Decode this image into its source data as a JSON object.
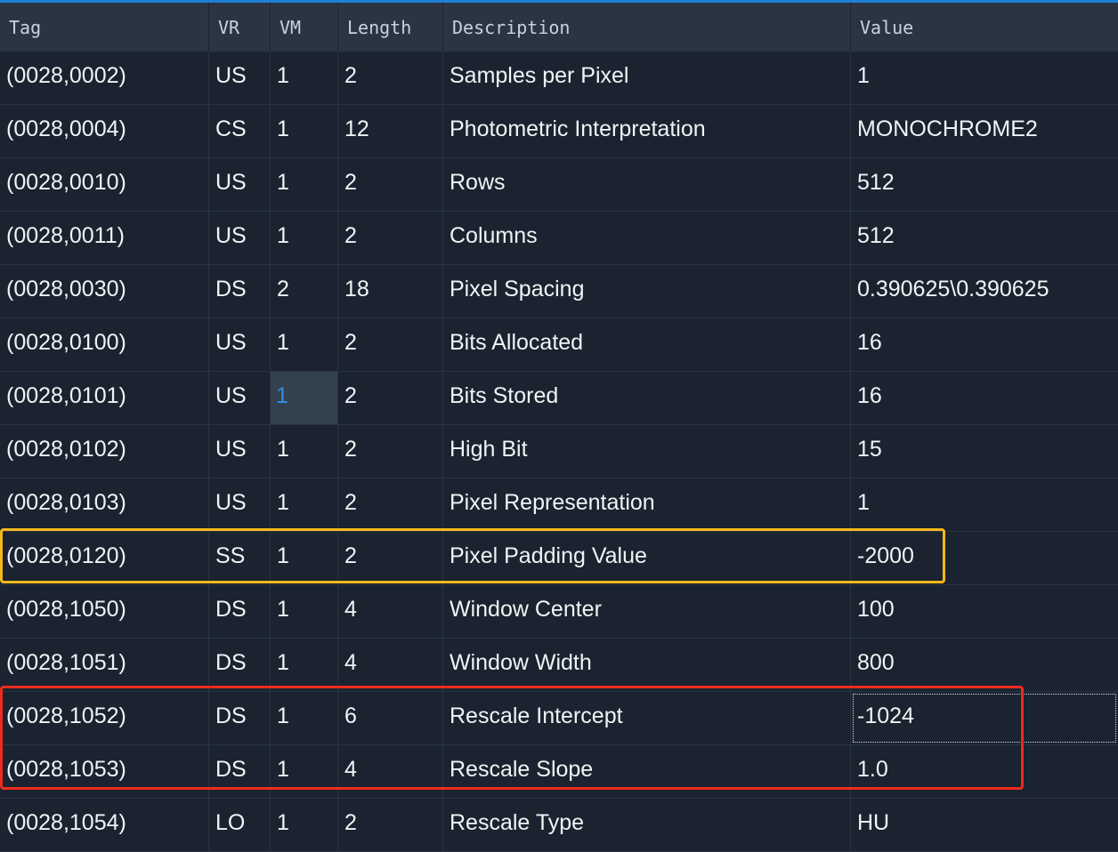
{
  "table": {
    "columns": [
      "Tag",
      "VR",
      "VM",
      "Length",
      "Description",
      "Value"
    ],
    "rows": [
      [
        "(0028,0002)",
        "US",
        "1",
        "2",
        "Samples per Pixel",
        "1"
      ],
      [
        "(0028,0004)",
        "CS",
        "1",
        "12",
        "Photometric Interpretation",
        "MONOCHROME2"
      ],
      [
        "(0028,0010)",
        "US",
        "1",
        "2",
        "Rows",
        "512"
      ],
      [
        "(0028,0011)",
        "US",
        "1",
        "2",
        "Columns",
        "512"
      ],
      [
        "(0028,0030)",
        "DS",
        "2",
        "18",
        "Pixel Spacing",
        "0.390625\\0.390625"
      ],
      [
        "(0028,0100)",
        "US",
        "1",
        "2",
        "Bits Allocated",
        "16"
      ],
      [
        "(0028,0101)",
        "US",
        "1",
        "2",
        "Bits Stored",
        "16"
      ],
      [
        "(0028,0102)",
        "US",
        "1",
        "2",
        "High Bit",
        "15"
      ],
      [
        "(0028,0103)",
        "US",
        "1",
        "2",
        "Pixel Representation",
        "1"
      ],
      [
        "(0028,0120)",
        "SS",
        "1",
        "2",
        "Pixel Padding Value",
        "-2000"
      ],
      [
        "(0028,1050)",
        "DS",
        "1",
        "4",
        "Window Center",
        "100"
      ],
      [
        "(0028,1051)",
        "DS",
        "1",
        "4",
        "Window Width",
        "800"
      ],
      [
        "(0028,1052)",
        "DS",
        "1",
        "6",
        "Rescale Intercept",
        "-1024"
      ],
      [
        "(0028,1053)",
        "DS",
        "1",
        "4",
        "Rescale Slope",
        "1.0"
      ],
      [
        "(0028,1054)",
        "LO",
        "1",
        "2",
        "Rescale Type",
        "HU"
      ]
    ]
  },
  "colors": {
    "background": "#1b2330",
    "header_background": "#2b3541",
    "top_accent": "#1f7fd6",
    "selected_cell_background": "#33414f",
    "selected_cell_text": "#2f8ee6",
    "highlight_yellow": "#f5b81c",
    "highlight_red": "#ef2a1f"
  }
}
